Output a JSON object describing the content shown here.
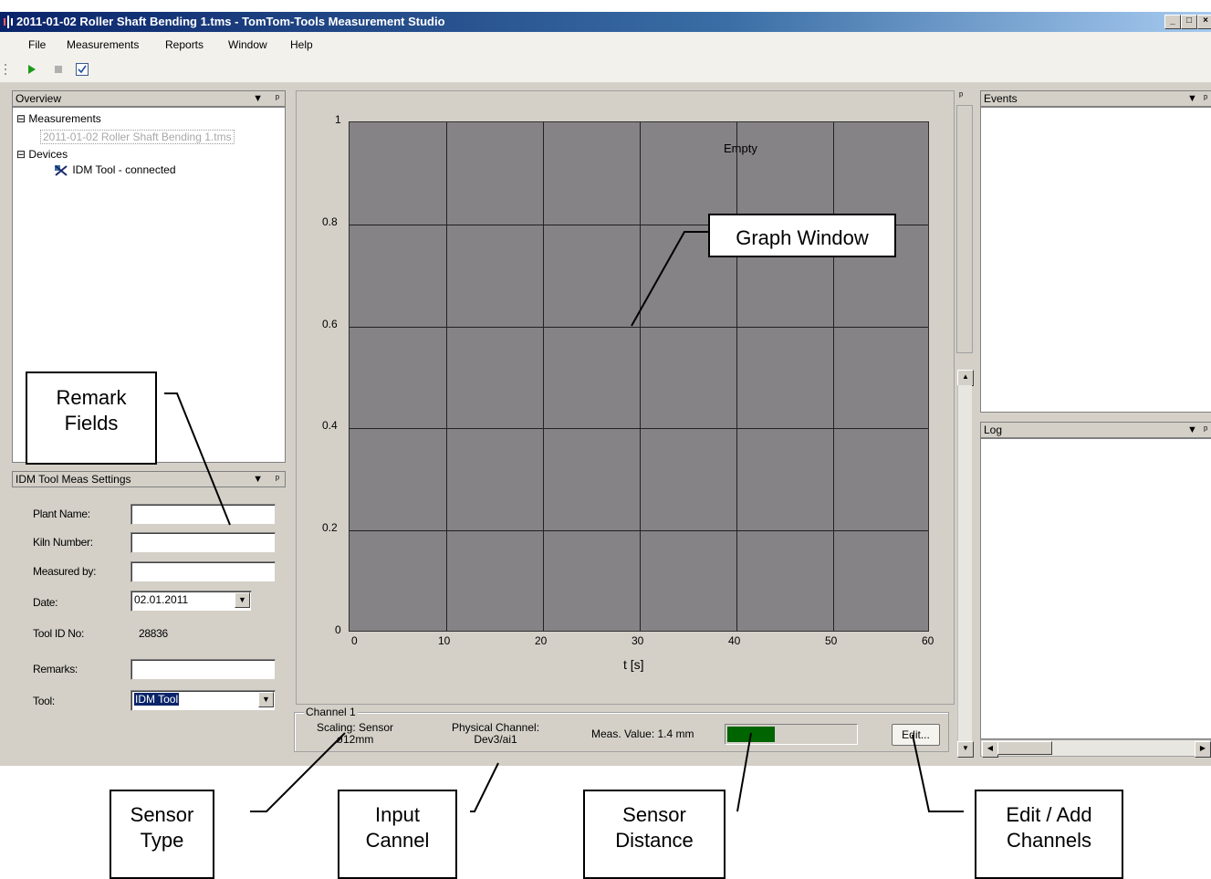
{
  "window": {
    "title": "2011-01-02 Roller Shaft Bending 1.tms - TomTom-Tools Measurement Studio",
    "minimize": "_",
    "maximize": "□",
    "close": "×"
  },
  "menu": [
    "File",
    "Measurements",
    "Reports",
    "Window",
    "Help"
  ],
  "overview": {
    "title": "Overview",
    "measurements_label": "Measurements",
    "measurement_file": "2011-01-02 Roller Shaft Bending 1.tms",
    "devices_label": "Devices",
    "device_status": "IDM Tool - connected",
    "collapse": "⊟"
  },
  "settings": {
    "title": "IDM Tool Meas Settings",
    "plant_label": "Plant Name:",
    "plant_value": "",
    "kiln_label": "Kiln Number:",
    "kiln_value": "",
    "measured_label": "Measured by:",
    "measured_value": "",
    "date_label": "Date:",
    "date_value": "02.01.2011",
    "toolid_label": "Tool ID No:",
    "toolid_value": "28836",
    "remarks_label": "Remarks:",
    "remarks_value": "",
    "tool_label": "Tool:",
    "tool_value": "IDM Tool"
  },
  "chart_data": {
    "type": "line",
    "title": "",
    "annotation": "Empty",
    "xlabel": "t [s]",
    "ylabel": "",
    "xlim": [
      0,
      60
    ],
    "ylim": [
      0,
      1
    ],
    "x_ticks": [
      "0",
      "10",
      "20",
      "30",
      "40",
      "50",
      "60"
    ],
    "y_ticks": [
      "0",
      "0.2",
      "0.4",
      "0.6",
      "0.8",
      "1"
    ],
    "grid": true,
    "series": []
  },
  "channel": {
    "group_label": "Channel 1",
    "scaling_line1": "Scaling: Sensor",
    "scaling_line2": "ø12mm",
    "physical_line1": "Physical Channel:",
    "physical_line2": "Dev3/ai1",
    "meas_value": "Meas. Value: 1.4 mm",
    "level_fraction": 0.37,
    "edit_button": "Edit..."
  },
  "events": {
    "title": "Events"
  },
  "log": {
    "title": "Log"
  },
  "callouts": {
    "graph_window": "Graph Window",
    "remark_line1": "Remark",
    "remark_line2": "Fields",
    "sensor_type_line1": "Sensor",
    "sensor_type_line2": "Type",
    "input_channel_line1": "Input",
    "input_channel_line2": "Cannel",
    "sensor_distance_line1": "Sensor",
    "sensor_distance_line2": "Distance",
    "edit_add_line1": "Edit / Add",
    "edit_add_line2": "Channels"
  },
  "colors": {
    "title_bar": "#0a246a",
    "plot_bg": "#858385",
    "level_fill": "#006400",
    "selection": "#0a246a"
  }
}
